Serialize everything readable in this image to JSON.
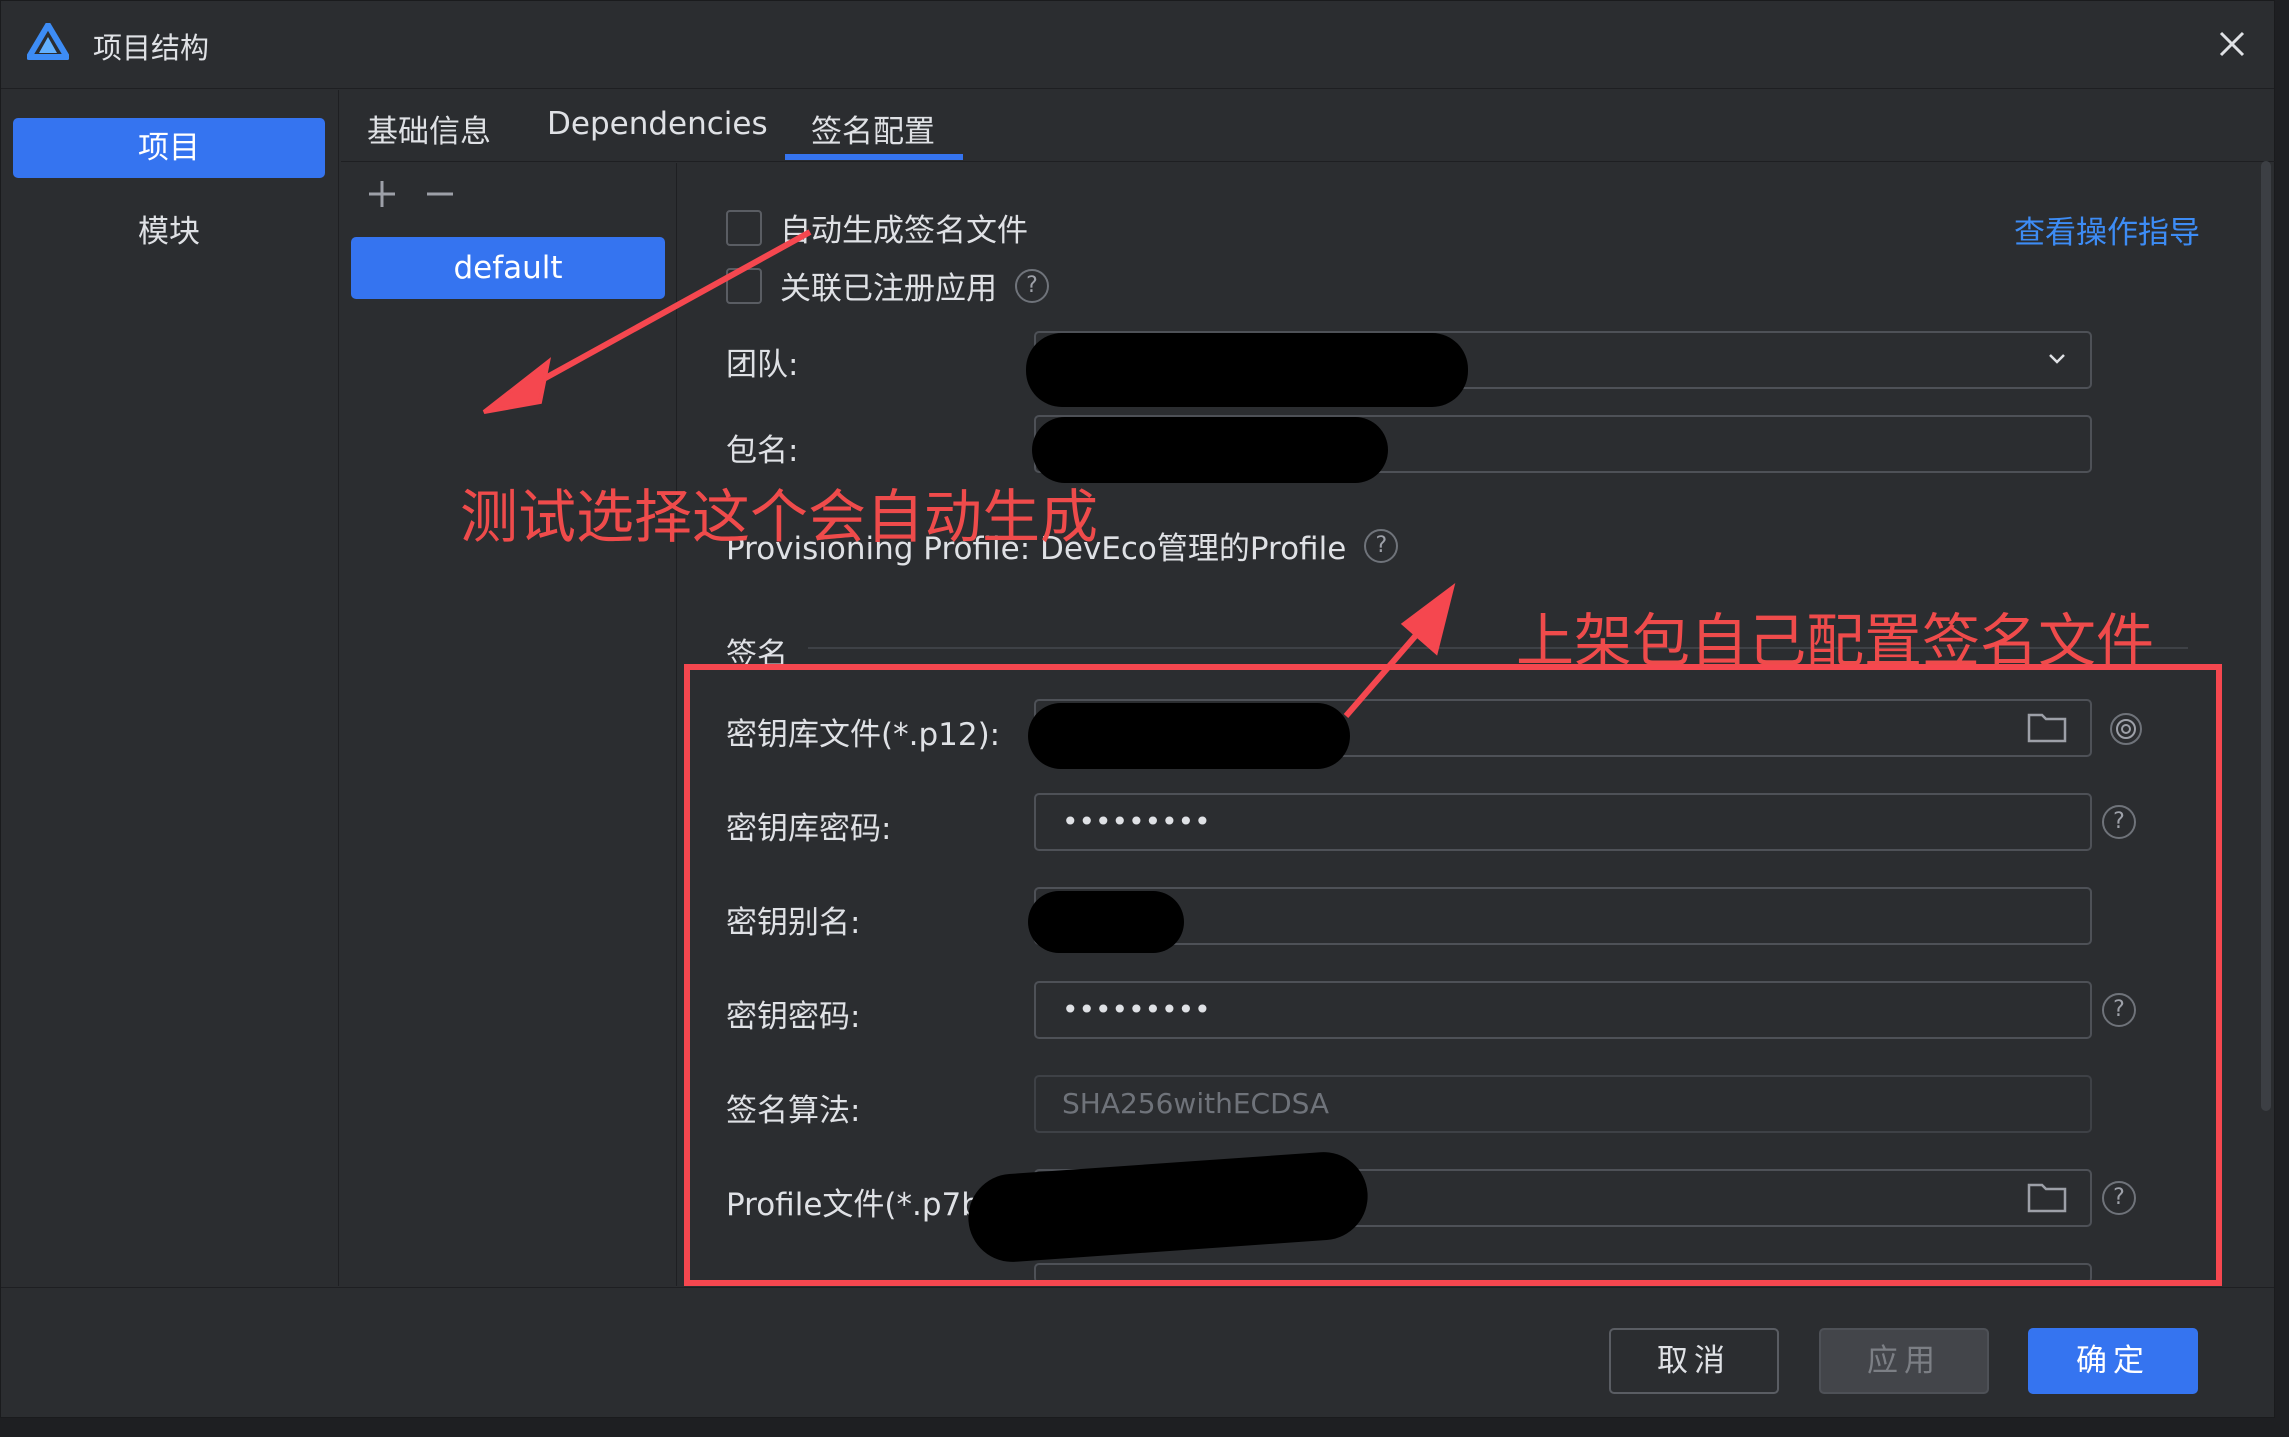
{
  "window": {
    "title": "项目结构"
  },
  "nav": {
    "items": [
      {
        "label": "项目",
        "active": true
      },
      {
        "label": "模块",
        "active": false
      }
    ]
  },
  "tabs": [
    {
      "label": "基础信息"
    },
    {
      "label": "Dependencies"
    },
    {
      "label": "签名配置",
      "active": true
    }
  ],
  "configs": {
    "items": [
      "default"
    ]
  },
  "form": {
    "auto_sign_label": "自动生成签名文件",
    "link_app_label": "关联已注册应用",
    "guide_link": "查看操作指导",
    "team_label": "团队:",
    "bundle_label": "包名:",
    "provisioning_text": "Provisioning Profile: DevEco管理的Profile",
    "sign_section": "签名",
    "keystore_label": "密钥库文件(*.p12):",
    "keystore_pwd_label": "密钥库密码:",
    "keystore_pwd_value": "•••••••••",
    "key_alias_label": "密钥别名:",
    "key_pwd_label": "密钥密码:",
    "key_pwd_value": "•••••••••",
    "algo_label": "签名算法:",
    "algo_value": "SHA256withECDSA",
    "profile_label": "Profile文件(*.p7b):"
  },
  "annotations": {
    "left_note": "测试选择这个会自动生成",
    "right_note": "上架包自己配置签名文件",
    "color": "#f5474f"
  },
  "footer": {
    "cancel": "取消",
    "apply": "应用",
    "ok": "确定"
  },
  "colors": {
    "accent": "#3574f0",
    "background": "#2b2d30",
    "link": "#3d8cf5"
  }
}
